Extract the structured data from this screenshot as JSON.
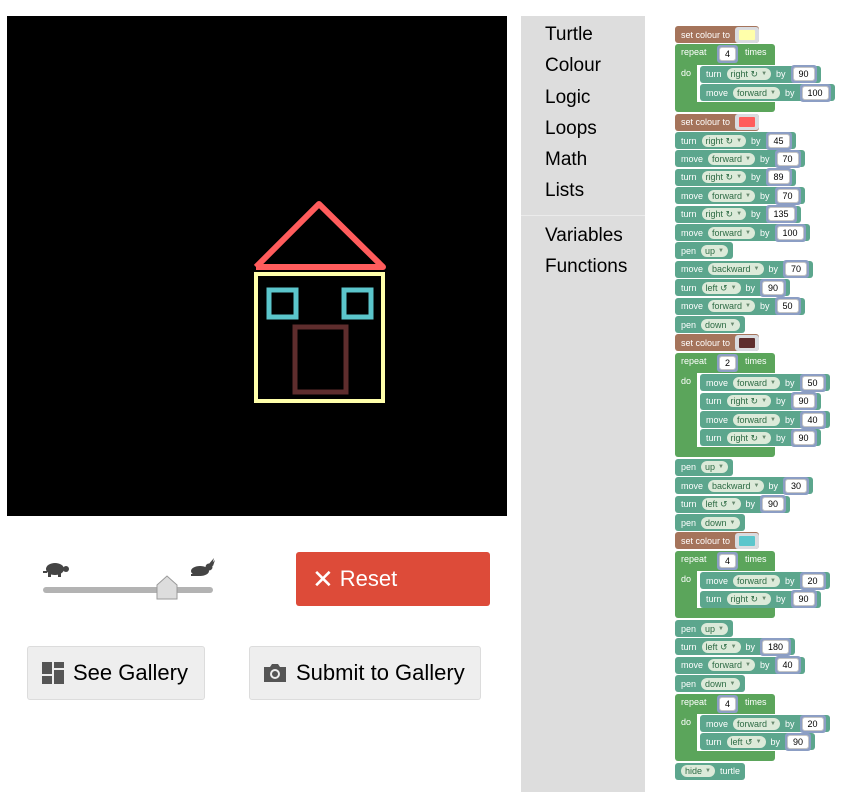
{
  "toolbox": {
    "categories": [
      "Turtle",
      "Colour",
      "Logic",
      "Loops",
      "Math",
      "Lists",
      "Variables",
      "Functions"
    ]
  },
  "controls": {
    "reset_label": "Reset",
    "gallery_label": "See Gallery",
    "submit_label": "Submit to Gallery",
    "speed_level": 0.72
  },
  "colors": {
    "house_walls": "#ffffaa",
    "roof": "#ff5c5c",
    "windows": "#5bc6cc",
    "door": "#5e2d2d",
    "turtle_block": "#5ca68d",
    "loop_block": "#5ba55b",
    "colour_block": "#a5745b",
    "reset_button": "#dd4b39"
  },
  "program": [
    {
      "type": "colour",
      "label": "set colour to",
      "color": "#ffffaa"
    },
    {
      "type": "repeat",
      "label": "repeat",
      "times": "4",
      "suffix": "times",
      "do": "do",
      "body": [
        {
          "cmd": "turn",
          "dd": "right ↻",
          "by": "by",
          "val": "90"
        },
        {
          "cmd": "move",
          "dd": "forward",
          "by": "by",
          "val": "100"
        }
      ]
    },
    {
      "type": "colour",
      "label": "set colour to",
      "color": "#ff5c5c"
    },
    {
      "cmd": "turn",
      "dd": "right ↻",
      "by": "by",
      "val": "45"
    },
    {
      "cmd": "move",
      "dd": "forward",
      "by": "by",
      "val": "70"
    },
    {
      "cmd": "turn",
      "dd": "right ↻",
      "by": "by",
      "val": "89"
    },
    {
      "cmd": "move",
      "dd": "forward",
      "by": "by",
      "val": "70"
    },
    {
      "cmd": "turn",
      "dd": "right ↻",
      "by": "by",
      "val": "135"
    },
    {
      "cmd": "move",
      "dd": "forward",
      "by": "by",
      "val": "100"
    },
    {
      "cmd": "pen",
      "dd": "up"
    },
    {
      "cmd": "move",
      "dd": "backward",
      "by": "by",
      "val": "70"
    },
    {
      "cmd": "turn",
      "dd": "left ↺",
      "by": "by",
      "val": "90"
    },
    {
      "cmd": "move",
      "dd": "forward",
      "by": "by",
      "val": "50"
    },
    {
      "cmd": "pen",
      "dd": "down"
    },
    {
      "type": "colour",
      "label": "set colour to",
      "color": "#5e2d2d"
    },
    {
      "type": "repeat",
      "label": "repeat",
      "times": "2",
      "suffix": "times",
      "do": "do",
      "body": [
        {
          "cmd": "move",
          "dd": "forward",
          "by": "by",
          "val": "50"
        },
        {
          "cmd": "turn",
          "dd": "right ↻",
          "by": "by",
          "val": "90"
        },
        {
          "cmd": "move",
          "dd": "forward",
          "by": "by",
          "val": "40"
        },
        {
          "cmd": "turn",
          "dd": "right ↻",
          "by": "by",
          "val": "90"
        }
      ]
    },
    {
      "cmd": "pen",
      "dd": "up"
    },
    {
      "cmd": "move",
      "dd": "backward",
      "by": "by",
      "val": "30"
    },
    {
      "cmd": "turn",
      "dd": "left ↺",
      "by": "by",
      "val": "90"
    },
    {
      "cmd": "pen",
      "dd": "down"
    },
    {
      "type": "colour",
      "label": "set colour to",
      "color": "#5bc6cc"
    },
    {
      "type": "repeat",
      "label": "repeat",
      "times": "4",
      "suffix": "times",
      "do": "do",
      "body": [
        {
          "cmd": "move",
          "dd": "forward",
          "by": "by",
          "val": "20"
        },
        {
          "cmd": "turn",
          "dd": "right ↻",
          "by": "by",
          "val": "90"
        }
      ]
    },
    {
      "cmd": "pen",
      "dd": "up"
    },
    {
      "cmd": "turn",
      "dd": "left ↺",
      "by": "by",
      "val": "180"
    },
    {
      "cmd": "move",
      "dd": "forward",
      "by": "by",
      "val": "40"
    },
    {
      "cmd": "pen",
      "dd": "down"
    },
    {
      "type": "repeat",
      "label": "repeat",
      "times": "4",
      "suffix": "times",
      "do": "do",
      "body": [
        {
          "cmd": "move",
          "dd": "forward",
          "by": "by",
          "val": "20"
        },
        {
          "cmd": "turn",
          "dd": "left ↺",
          "by": "by",
          "val": "90"
        }
      ]
    },
    {
      "cmd": "hide",
      "dd": "hide",
      "suffix": "turtle"
    }
  ]
}
